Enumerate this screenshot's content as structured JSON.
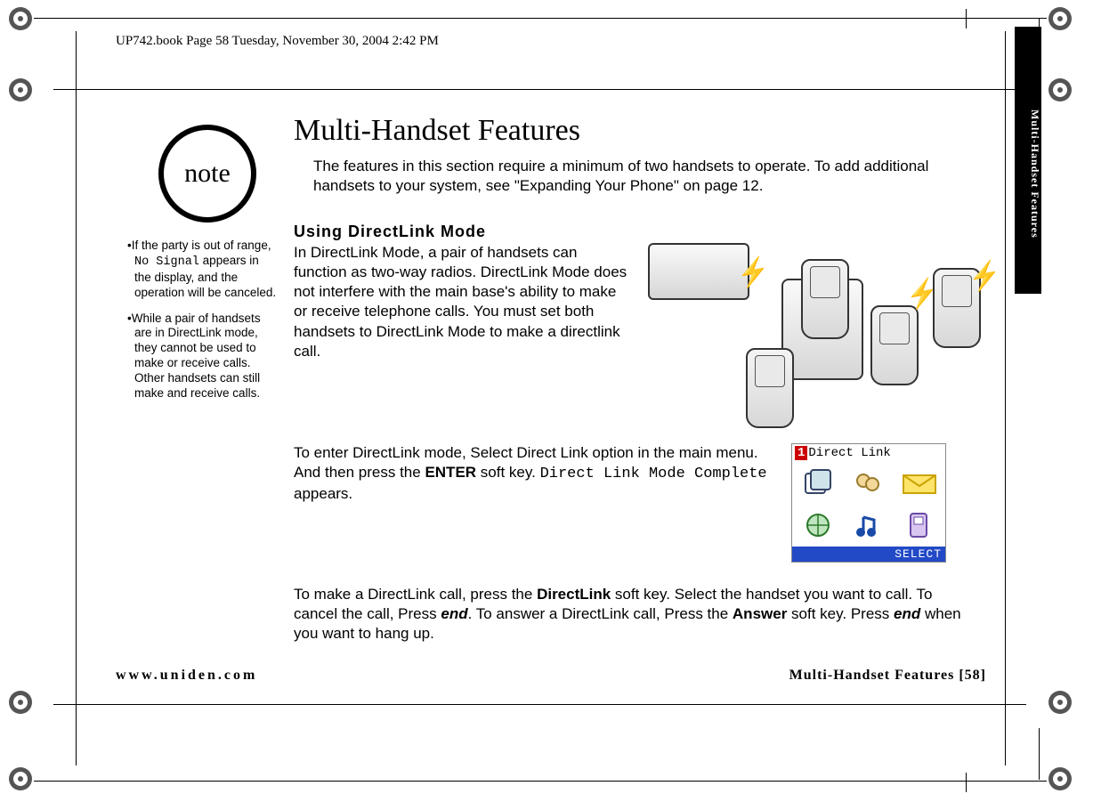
{
  "bookinfo": "UP742.book  Page 58  Tuesday, November 30, 2004  2:42 PM",
  "tab_label": "Multi-Handset Features",
  "note": {
    "label": "note",
    "item1_pre": "If the party is out of range, ",
    "item1_mono": "No Signal",
    "item1_post": " appears in the display, and the operation will be canceled.",
    "item2": "While a pair of handsets are in DirectLink mode, they cannot be used to make or receive calls. Other handsets can still make and receive calls."
  },
  "main": {
    "title": "Multi-Handset Features",
    "intro": "The features in this section require a minimum of two handsets to operate. To add additional handsets to your system, see \"Expanding Your Phone\" on page 12.",
    "subhead": "Using DirectLink Mode",
    "p1": "In DirectLink Mode, a pair of handsets can function as two-way radios. DirectLink Mode does not interfere with the main base's ability to make or receive telephone calls. You must set both handsets to DirectLink Mode to make a directlink call.",
    "p2a": "To enter DirectLink mode, Select Direct Link option in the main menu. And then press the ",
    "p2_enter": "ENTER",
    "p2b": " soft key. ",
    "p2_mono": "Direct Link Mode Complete",
    "p2c": " appears.",
    "p3a": "To make a DirectLink call, press the ",
    "p3_dl": "DirectLink",
    "p3b": " soft key. Select the handset you want to call. To cancel the call, Press ",
    "p3_end1": "end",
    "p3c": ". To answer a DirectLink call, Press the ",
    "p3_ans": "Answer",
    "p3d": " soft key. Press ",
    "p3_end2": "end",
    "p3e": " when you want to hang up."
  },
  "screen": {
    "num": "1",
    "title": "Direct Link",
    "footer": "SELECT"
  },
  "footer": {
    "left": "www.uniden.com",
    "right": "Multi-Handset Features [58]"
  }
}
